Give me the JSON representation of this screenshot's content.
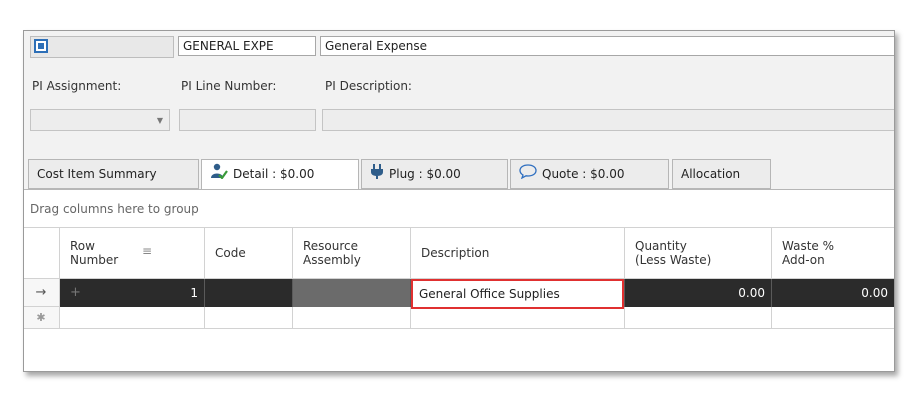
{
  "header": {
    "code": "GENERAL EXPE",
    "name": "General Expense",
    "color_icon": "square-swatch-icon",
    "accent_color": "#2d6fb7"
  },
  "labels": {
    "pi_assignment": "PI Assignment:",
    "pi_line_number": "PI Line Number:",
    "pi_description": "PI Description:"
  },
  "tabs": [
    {
      "label": "Cost Item Summary",
      "icon": ""
    },
    {
      "label": "Detail : $0.00",
      "icon": "person-check-icon"
    },
    {
      "label": "Plug : $0.00",
      "icon": "plug-icon"
    },
    {
      "label": "Quote : $0.00",
      "icon": "speech-bubble-icon"
    },
    {
      "label": "Allocation",
      "icon": ""
    }
  ],
  "grid": {
    "group_hint": "Drag columns here to group",
    "columns": [
      {
        "line1": "Row",
        "line2": "Number"
      },
      {
        "line1": "Code",
        "line2": ""
      },
      {
        "line1": "Resource",
        "line2": "Assembly"
      },
      {
        "line1": "Description",
        "line2": ""
      },
      {
        "line1": "Quantity",
        "line2": "(Less Waste)"
      },
      {
        "line1": "Waste %",
        "line2": "Add-on"
      }
    ],
    "rows": [
      {
        "indicator": "→",
        "row_number": "1",
        "code": "",
        "resource_assembly": "",
        "description": "General Office Supplies",
        "quantity": "0.00",
        "waste": "0.00"
      }
    ],
    "new_row_indicator": "✱"
  }
}
